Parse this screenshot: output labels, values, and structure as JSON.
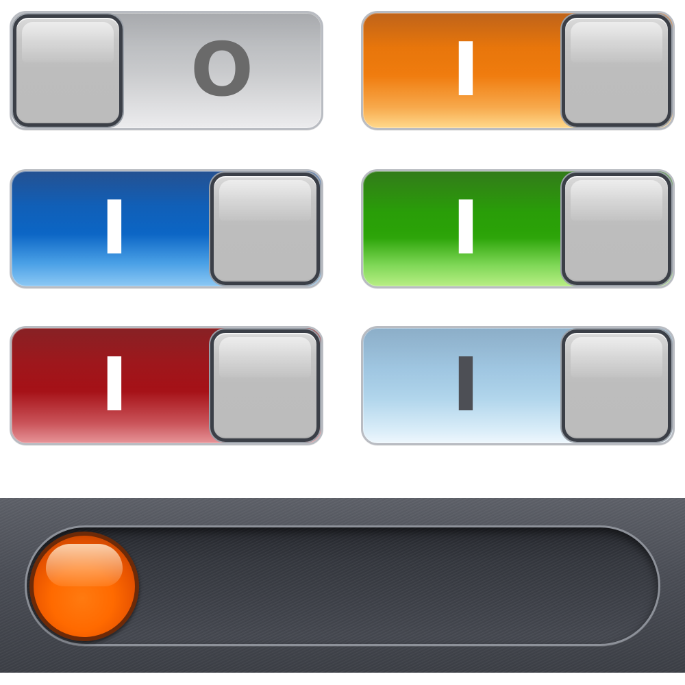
{
  "toggles": [
    {
      "id": "power",
      "state": "off",
      "symbol": "O",
      "track_color": "#cfd0d2",
      "symbol_color": "#6a6a6a"
    },
    {
      "id": "orange",
      "state": "on",
      "symbol": "I",
      "track_color": "#f07d10",
      "symbol_color": "#ffffff"
    },
    {
      "id": "blue",
      "state": "on",
      "symbol": "I",
      "track_color": "#0d67c6",
      "symbol_color": "#ffffff"
    },
    {
      "id": "green",
      "state": "on",
      "symbol": "I",
      "track_color": "#229a00",
      "symbol_color": "#ffffff"
    },
    {
      "id": "red",
      "state": "on",
      "symbol": "I",
      "track_color": "#a61218",
      "symbol_color": "#ffffff"
    },
    {
      "id": "lightblue",
      "state": "on",
      "symbol": "I",
      "track_color": "#b2d6ec",
      "symbol_color": "#4d4f55"
    }
  ],
  "slider": {
    "value": 0,
    "knob_color": "#ff6a00",
    "track_color": "#35383f",
    "panel_color": "#4a4d55"
  }
}
